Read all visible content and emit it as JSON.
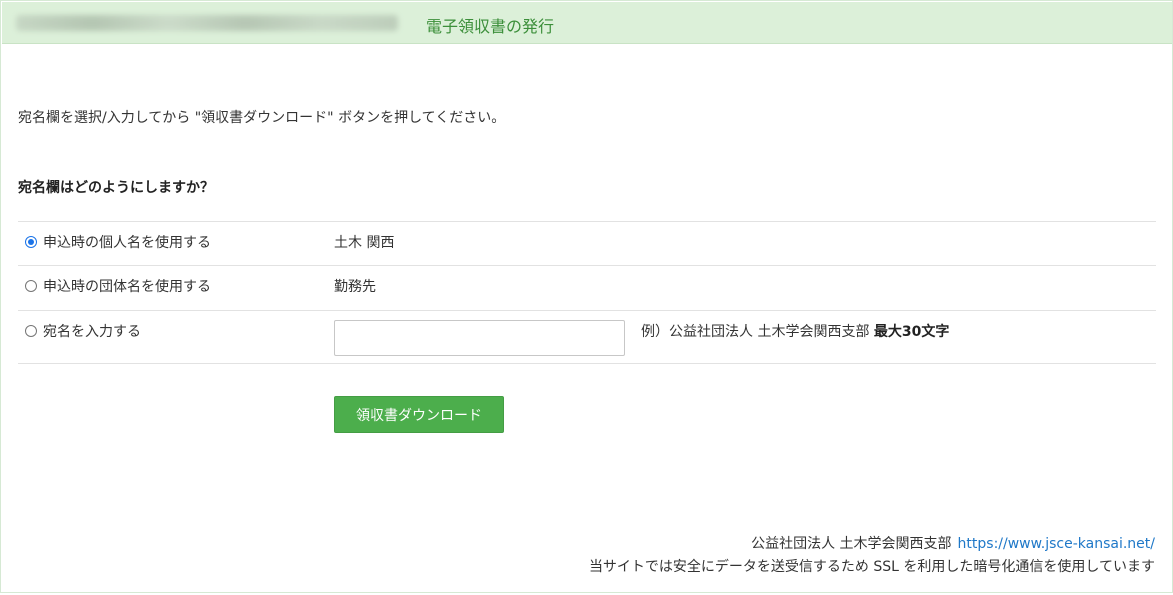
{
  "header": {
    "title": "電子領収書の発行"
  },
  "instruction": "宛名欄を選択/入力してから \"領収書ダウンロード\" ボタンを押してください。",
  "question": "宛名欄はどのようにしますか？",
  "options": [
    {
      "label": "申込時の個人名を使用する",
      "value": "土木 関西",
      "selected": true
    },
    {
      "label": "申込時の団体名を使用する",
      "value": "勤務先",
      "selected": false
    },
    {
      "label": "宛名を入力する",
      "input_value": "",
      "selected": false
    }
  ],
  "example": {
    "text": "例）公益社団法人 土木学会関西支部",
    "limit": "最大30文字"
  },
  "download_button": "領収書ダウンロード",
  "footer": {
    "org": "公益社団法人 土木学会関西支部",
    "link": "https://www.jsce-kansai.net/",
    "ssl_notice": "当サイトでは安全にデータを送受信するため SSL を利用した暗号化通信を使用しています"
  },
  "colors": {
    "header_bg": "#dcf0d9",
    "header_text": "#3c8f3a",
    "button_bg": "#4cae4c",
    "link": "#1f78c8",
    "radio_selected": "#1a73e8"
  }
}
